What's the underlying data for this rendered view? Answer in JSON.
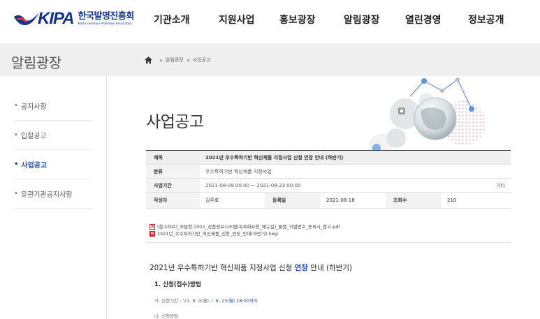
{
  "header": {
    "logo_text": "KIPA",
    "logo_ko": "한국발명진흥회",
    "logo_en": "Korea Invention Promotion Association",
    "nav": [
      "기관소개",
      "지원사업",
      "홍보광장",
      "알림광장",
      "열린경영",
      "정보공개"
    ]
  },
  "band": {
    "title": "알림광장",
    "breadcrumb": [
      "알림광장",
      "사업공고"
    ]
  },
  "sidebar": {
    "items": [
      {
        "label": "공지사항",
        "active": false
      },
      {
        "label": "입찰공고",
        "active": false
      },
      {
        "label": "사업공고",
        "active": true
      },
      {
        "label": "유관기관공지사항",
        "active": false
      }
    ]
  },
  "main": {
    "title": "사업공고",
    "table": {
      "title_label": "제목",
      "title_value": "2021년 우수특허기반 혁신제품 지정사업 신청 연장 안내 (하반기)",
      "category_label": "분류",
      "category_value": "우수특허기반 혁신제품 지정사업",
      "period_label": "사업기간",
      "period_value": "2021-08-09 00:00 ~ 2021-08-23 00:00",
      "period_extra": "기타",
      "author_label": "작성자",
      "author_value": "김주호",
      "date_label": "등록일",
      "date_value": "2021-08-18",
      "views_label": "조회수",
      "views_value": "210"
    },
    "files": [
      {
        "type": "pdf",
        "name": "(참고자료)_조달청-2021_상품정보시스템(목록화요청_매뉴얼)_물품_식별번호_등록시_참고.pdf"
      },
      {
        "type": "hwp",
        "name": "2021년_우수특허기반_혁신제품_신청_연장_안내(하반기).hwp"
      }
    ],
    "content": {
      "title_before": "2021년 우수특허기반 혁신제품 지정사업 신청 ",
      "title_highlight": "연장",
      "title_after": " 안내 (하반기)",
      "section1": "1. 신청(접수)방법",
      "item_ga_prefix": "가. 신청기간 : '21. 8. 9(월) ~ ",
      "item_ga_highlight": "8. 23(월) 18:00까지",
      "item_na": "나. 신청방법"
    }
  },
  "colors": {
    "brand": "#14338a",
    "accent": "#1d49c0",
    "band_bg": "#efefef"
  }
}
